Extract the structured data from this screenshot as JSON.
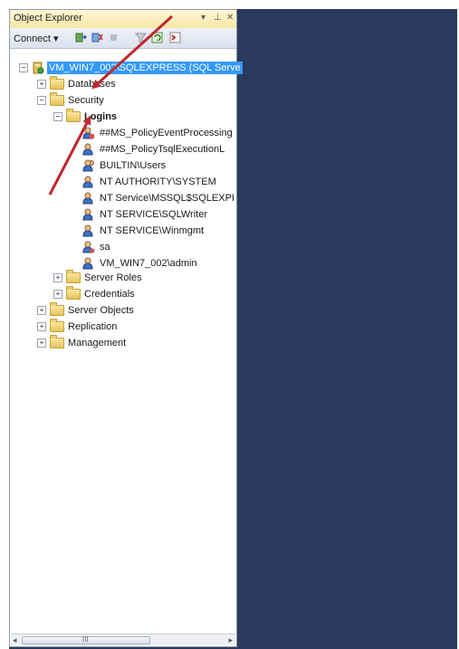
{
  "panel": {
    "title": "Object Explorer",
    "controls": {
      "pin_dropdown": "▾",
      "pin": "⊥",
      "close": "✕"
    }
  },
  "toolbar": {
    "connect_label": "Connect ▾",
    "icons": [
      "connect-object-explorer-icon",
      "disconnect-icon",
      "stop-icon",
      "filter-icon",
      "refresh-icon",
      "start-powershell-icon"
    ]
  },
  "tree": {
    "server": "VM_WIN7_002\\SQLEXPRESS (SQL Serve",
    "databases": "Databases",
    "security": "Security",
    "logins": "Logins",
    "login_items": [
      "##MS_PolicyEventProcessing",
      "##MS_PolicyTsqlExecutionL",
      "BUILTIN\\Users",
      "NT AUTHORITY\\SYSTEM",
      "NT Service\\MSSQL$SQLEXPI",
      "NT SERVICE\\SQLWriter",
      "NT SERVICE\\Winmgmt",
      "sa",
      "VM_WIN7_002\\admin"
    ],
    "server_roles": "Server Roles",
    "credentials": "Credentials",
    "server_objects": "Server Objects",
    "replication": "Replication",
    "management": "Management"
  },
  "scrollbar": {
    "left_arrow": "◂",
    "right_arrow": "▸",
    "grip": "III"
  },
  "colors": {
    "selection": "#3399ff",
    "background_pane": "#2a3a5c",
    "annotation_arrow": "#c0282d"
  }
}
